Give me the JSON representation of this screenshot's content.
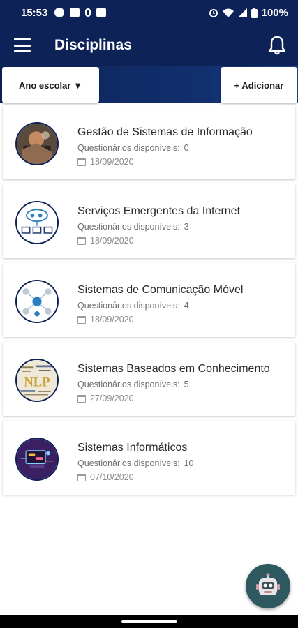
{
  "status_bar": {
    "time": "15:53",
    "battery": "100%",
    "left_icons": [
      "p-icon",
      "calendar-notification-icon",
      "location-icon",
      "sigma-icon"
    ],
    "right_icons": [
      "alarm-icon",
      "wifi-icon",
      "signal-icon",
      "battery-icon"
    ]
  },
  "appbar": {
    "title": "Disciplinas",
    "menu_icon": "hamburger-menu-icon",
    "notification_icon": "bell-icon"
  },
  "toolbar": {
    "year_label": "Ano escolar ▼",
    "add_label": "+ Adicionar"
  },
  "courses": [
    {
      "title": "Gestão de Sistemas de Informação",
      "sub_label": "Questionários disponíveis:",
      "count": "0",
      "date": "18/09/2020",
      "avatar": "business-photo"
    },
    {
      "title": "Serviços Emergentes da Internet",
      "sub_label": "Questionários disponíveis:",
      "count": "3",
      "date": "18/09/2020",
      "avatar": "cloud-network-illustration"
    },
    {
      "title": "Sistemas de Comunicação Móvel",
      "sub_label": "Questionários disponíveis:",
      "count": "4",
      "date": "18/09/2020",
      "avatar": "people-network-illustration"
    },
    {
      "title": "Sistemas Baseados em Conhecimento",
      "sub_label": "Questionários disponíveis:",
      "count": "5",
      "date": "27/09/2020",
      "avatar": "nlp-wordcloud"
    },
    {
      "title": "Sistemas Informáticos",
      "sub_label": "Questionários disponíveis:",
      "count": "10",
      "date": "07/10/2020",
      "avatar": "computer-circuit-illustration"
    }
  ],
  "fab": {
    "icon": "robot-icon"
  },
  "colors": {
    "primary": "#0d2357",
    "fab": "#2e5960",
    "card_text": "#2b2b2b"
  }
}
